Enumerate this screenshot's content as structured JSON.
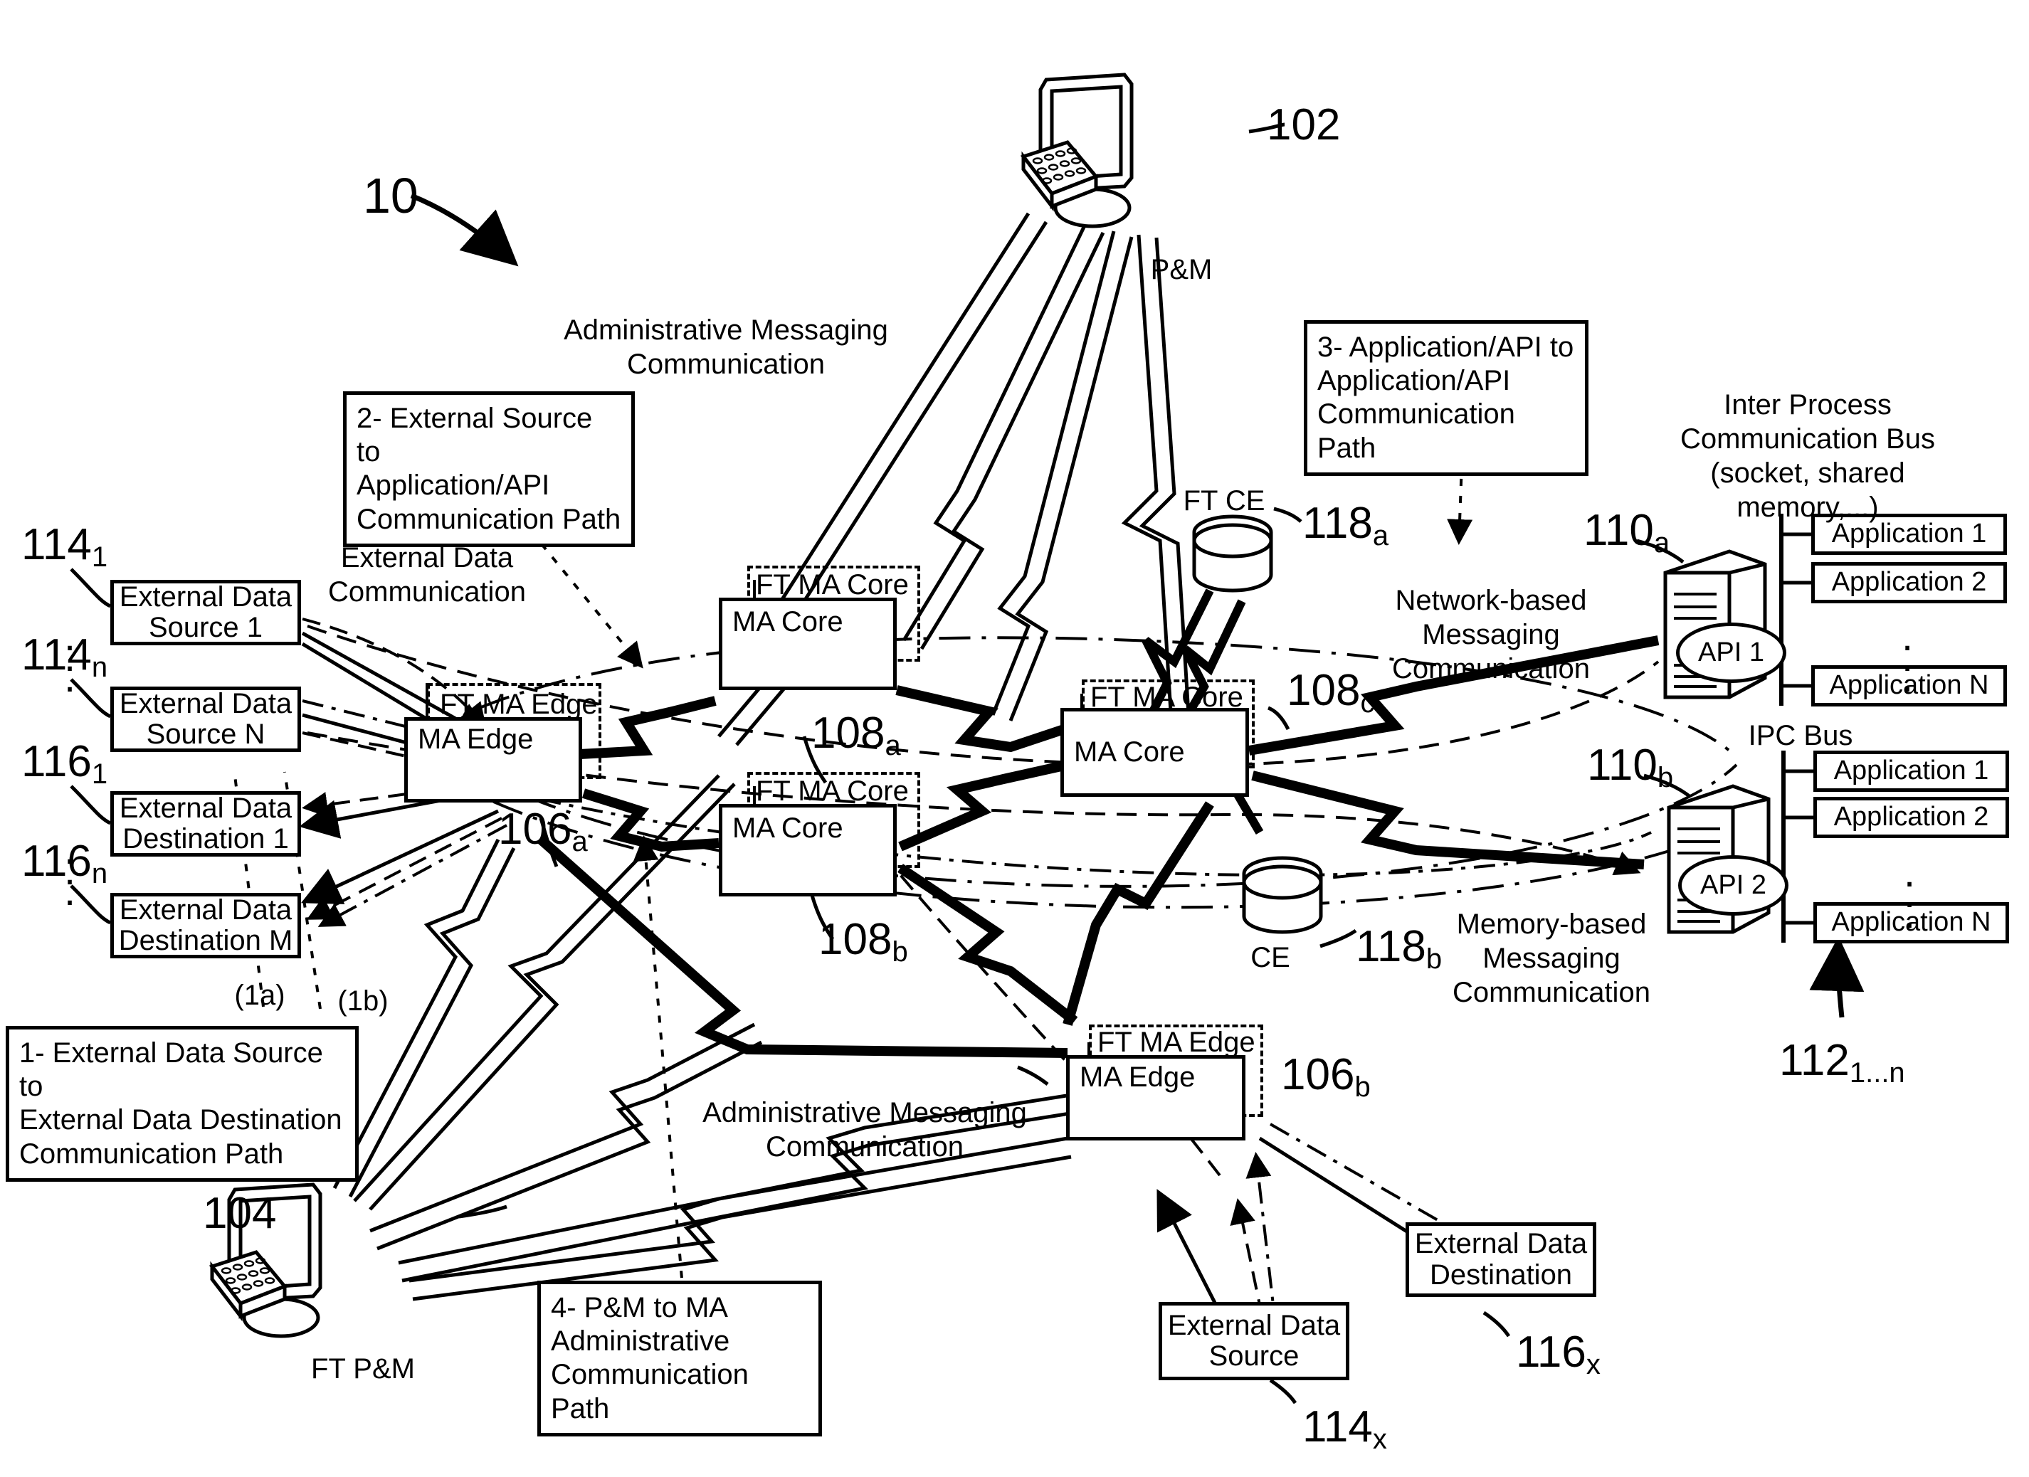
{
  "figure": {
    "number": "10",
    "domain": "patent-network-architecture-diagram"
  },
  "refs": {
    "pm_workstation": "102",
    "ft_pm_workstation": "104",
    "ma_edge_a": "106",
    "ma_edge_a_sub": "a",
    "ma_edge_b": "106",
    "ma_edge_b_sub": "b",
    "ma_core_a": "108",
    "ma_core_a_sub": "a",
    "ma_core_b": "108",
    "ma_core_b_sub": "b",
    "ma_core_c": "108",
    "ma_core_c_sub": "c",
    "api_server_a": "110",
    "api_server_a_sub": "a",
    "api_server_b": "110",
    "api_server_b_sub": "b",
    "applications": "112",
    "applications_sub": "1...n",
    "ext_src_1": "114",
    "ext_src_1_sub": "1",
    "ext_src_n": "114",
    "ext_src_n_sub": "n",
    "ext_src_x": "114",
    "ext_src_x_sub": "x",
    "ext_dst_1": "116",
    "ext_dst_1_sub": "1",
    "ext_dst_n": "116",
    "ext_dst_n_sub": "n",
    "ext_dst_x": "116",
    "ext_dst_x_sub": "x",
    "ft_ce": "118",
    "ft_ce_sub": "a",
    "ce": "118",
    "ce_sub": "b",
    "figure_ref": "10"
  },
  "nodes": {
    "pm_label": "P&M",
    "ft_pm_label": "FT P&M",
    "ma_edge_a": "MA Edge",
    "ma_edge_b": "MA Edge",
    "ft_ma_edge_a": "FT MA Edge",
    "ft_ma_edge_b": "FT MA Edge",
    "ma_core_a": "MA Core",
    "ma_core_b": "MA Core",
    "ma_core_c": "MA Core",
    "ft_ma_core_a": "FT MA Core",
    "ft_ma_core_b": "FT MA Core",
    "ft_ma_core_c": "FT MA Core",
    "ext_src_1": "External Data\nSource 1",
    "ext_src_n": "External Data\nSource N",
    "ext_dst_1": "External Data\nDestination 1",
    "ext_dst_m": "External Data\nDestination M",
    "ext_src_x": "External Data\nSource",
    "ext_dst_x": "External Data\nDestination",
    "ft_ce_label": "FT CE",
    "ce_label": "CE",
    "api_1": "API 1",
    "api_2": "API 2"
  },
  "applications": {
    "bus_a_label": "Inter Process\nCommunication Bus\n(socket, shared\nmemory,...)",
    "bus_b_label": "IPC Bus",
    "group_a": [
      "Application 1",
      "Application 2",
      "Application N"
    ],
    "group_b": [
      "Application 1",
      "Application 2",
      "Application N"
    ],
    "ellipsis": "⋮"
  },
  "callouts": [
    {
      "id": "callout-1",
      "text": "1- External Data Source to\nExternal Data Destination\nCommunication Path"
    },
    {
      "id": "callout-2",
      "text": "2- External Source to\nApplication/API\nCommunication Path"
    },
    {
      "id": "callout-3",
      "text": "3- Application/API to\nApplication/API\nCommunication Path"
    },
    {
      "id": "callout-4",
      "text": "4- P&M to MA\nAdministrative\nCommunication Path"
    }
  ],
  "annotations": {
    "admin_msg_top": "Administrative Messaging\nCommunication",
    "admin_msg_bottom": "Administrative Messaging\nCommunication",
    "external_data_comm": "External Data\nCommunication",
    "network_based": "Network-based\nMessaging\nCommunication",
    "memory_based": "Memory-based\nMessaging\nCommunication",
    "path_1a": "(1a)",
    "path_1b": "(1b)"
  },
  "colors": {
    "ink": "#000000",
    "paper": "#ffffff"
  }
}
